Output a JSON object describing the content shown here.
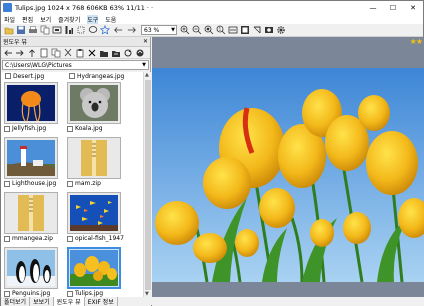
{
  "window": {
    "title": "Tulips.jpg   1024 x 768  606KB  63%   11/11  ·  ·",
    "minimize": "—",
    "maximize": "☐",
    "close": "✕"
  },
  "menu": [
    "파일",
    "편집",
    "보기",
    "즐겨찾기",
    "도구",
    "도움"
  ],
  "menu_active_index": 4,
  "toolbar": {
    "zoom": "63 %",
    "icons": [
      "open-folder-icon",
      "save-icon",
      "print-icon",
      "copy-icon",
      "fit-icon",
      "info-icon",
      "crop-icon",
      "lasso-icon",
      "favorite-icon",
      "back-arrow-icon",
      "forward-arrow-icon",
      "zoom-in-icon",
      "zoom-out-icon",
      "zoom-fit-icon",
      "zoom-original-icon",
      "zoom-width-icon",
      "fullscreen-icon",
      "rotate-icon",
      "slideshow-icon",
      "settings-icon"
    ]
  },
  "left_pane": {
    "header": "윈도우 뷰",
    "pin": "✕",
    "path": "C:\\Users\\WLG\\Pictures",
    "top_row": [
      "Desert.jpg",
      "Hydrangeas.jpg"
    ],
    "thumbnails": [
      {
        "name": "Jellyfish.jpg",
        "kind": "jellyfish"
      },
      {
        "name": "Koala.jpg",
        "kind": "koala"
      },
      {
        "name": "Lighthouse.jpg",
        "kind": "lighthouse"
      },
      {
        "name": "mam.zip",
        "kind": "zip"
      },
      {
        "name": "mmangea.zip",
        "kind": "zip"
      },
      {
        "name": "opical-fish_1947...",
        "kind": "fish"
      },
      {
        "name": "Penguins.jpg",
        "kind": "penguins"
      },
      {
        "name": "Tulips.jpg",
        "kind": "tulips",
        "selected": true
      }
    ]
  },
  "bottom_tabs": [
    "폴더보기",
    "보보기",
    "윈도우 뷰",
    "EXIF 정보"
  ],
  "viewer": {
    "stars": "★★",
    "accent": "#3d8ee0",
    "background": "#7b8799"
  }
}
